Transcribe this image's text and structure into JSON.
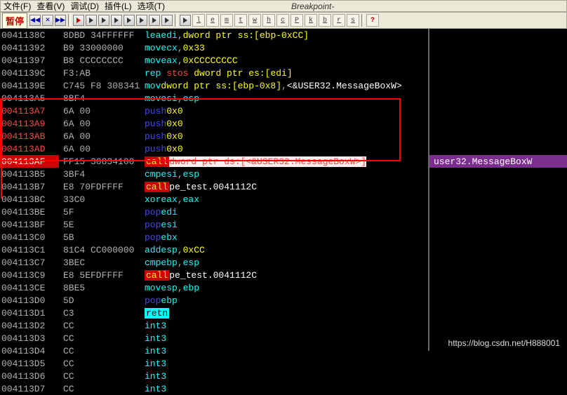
{
  "menu": {
    "file": "文件(F)",
    "view": "查看(V)",
    "debug": "调试(D)",
    "plugins": "插件(L)",
    "options": "选项(T)",
    "bp": "Breakpoint-"
  },
  "status": "暂停",
  "toolbarButtons": [
    "◀◀",
    "✕",
    "▶▶",
    "▶",
    "‖",
    "◀",
    "▶",
    "↓",
    "↓",
    "↔",
    "↔",
    "→",
    "l",
    "e",
    "m",
    "t",
    "w",
    "h",
    "c",
    "P",
    "k",
    "b",
    "r",
    "s"
  ],
  "qmark": "?",
  "rows": [
    {
      "a": "0041138C",
      "b": "8DBD 34FFFFFF",
      "m": "lea",
      "mc": "teal",
      "o": [
        {
          "t": "edi",
          "c": "teal"
        },
        {
          "t": ",",
          "c": "gray"
        },
        {
          "t": "dword ptr ss:[ebp-0xCC]",
          "c": "yel"
        }
      ]
    },
    {
      "a": "00411392",
      "b": "B9 33000000",
      "m": "mov",
      "mc": "teal",
      "o": [
        {
          "t": "ecx",
          "c": "teal"
        },
        {
          "t": ",",
          "c": "gray"
        },
        {
          "t": "0x33",
          "c": "yel"
        }
      ]
    },
    {
      "a": "00411397",
      "b": "B8 CCCCCCCC",
      "m": "mov",
      "mc": "teal",
      "o": [
        {
          "t": "eax",
          "c": "teal"
        },
        {
          "t": ",",
          "c": "gray"
        },
        {
          "t": "0xCCCCCCCC",
          "c": "yel"
        }
      ]
    },
    {
      "a": "0041139C",
      "b": "F3:AB",
      "m": "rep stos",
      "mc": "red-y",
      "o": [
        {
          "t": "dword ptr es:[edi]",
          "c": "yel"
        }
      ]
    },
    {
      "a": "0041139E",
      "b": "C745 F8 308341",
      "m": "mov",
      "mc": "teal",
      "o": [
        {
          "t": "dword ptr ss:[ebp-0x8]",
          "c": "yel"
        },
        {
          "t": ",",
          "c": "gray"
        },
        {
          "t": "<&USER32.MessageBoxW>",
          "c": "white"
        }
      ]
    },
    {
      "a": "004113A5",
      "b": "8BF4",
      "m": "mov",
      "mc": "teal",
      "o": [
        {
          "t": "esi",
          "c": "teal"
        },
        {
          "t": ",",
          "c": "gray"
        },
        {
          "t": "esp",
          "c": "teal"
        }
      ]
    },
    {
      "a": "004113A7",
      "b": "6A 00",
      "m": "push",
      "mc": "blue",
      "o": [
        {
          "t": "0x0",
          "c": "yel"
        }
      ],
      "red": true
    },
    {
      "a": "004113A9",
      "b": "6A 00",
      "m": "push",
      "mc": "blue",
      "o": [
        {
          "t": "0x0",
          "c": "yel"
        }
      ],
      "red": true
    },
    {
      "a": "004113AB",
      "b": "6A 00",
      "m": "push",
      "mc": "blue",
      "o": [
        {
          "t": "0x0",
          "c": "yel"
        }
      ],
      "red": true
    },
    {
      "a": "004113AD",
      "b": "6A 00",
      "m": "push",
      "mc": "blue",
      "o": [
        {
          "t": "0x0",
          "c": "yel"
        }
      ],
      "red": true
    },
    {
      "a": "004113AF",
      "b": "FF15 30834100",
      "m": "call",
      "mc": "redbg",
      "o": [
        {
          "t": "dword ptr ds:[<&USER32.MessageBoxW>]",
          "c": "hl"
        }
      ],
      "sel": true,
      "cmt": "user32.MessageBoxW"
    },
    {
      "a": "004113B5",
      "b": "3BF4",
      "m": "cmp",
      "mc": "teal",
      "o": [
        {
          "t": "esi",
          "c": "teal"
        },
        {
          "t": ",",
          "c": "gray"
        },
        {
          "t": "esp",
          "c": "teal"
        }
      ]
    },
    {
      "a": "004113B7",
      "b": "E8 70FDFFFF",
      "m": "call",
      "mc": "redbg",
      "o": [
        {
          "t": "pe_test.0041112C",
          "c": "white"
        }
      ]
    },
    {
      "a": "004113BC",
      "b": "33C0",
      "m": "xor",
      "mc": "teal",
      "o": [
        {
          "t": "eax",
          "c": "teal"
        },
        {
          "t": ",",
          "c": "gray"
        },
        {
          "t": "eax",
          "c": "teal"
        }
      ]
    },
    {
      "a": "004113BE",
      "b": "5F",
      "m": "pop",
      "mc": "blue",
      "o": [
        {
          "t": "edi",
          "c": "teal"
        }
      ]
    },
    {
      "a": "004113BF",
      "b": "5E",
      "m": "pop",
      "mc": "blue",
      "o": [
        {
          "t": "esi",
          "c": "teal"
        }
      ]
    },
    {
      "a": "004113C0",
      "b": "5B",
      "m": "pop",
      "mc": "blue",
      "o": [
        {
          "t": "ebx",
          "c": "teal"
        }
      ]
    },
    {
      "a": "004113C1",
      "b": "81C4 CC000000",
      "m": "add",
      "mc": "teal",
      "o": [
        {
          "t": "esp",
          "c": "teal"
        },
        {
          "t": ",",
          "c": "gray"
        },
        {
          "t": "0xCC",
          "c": "yel"
        }
      ]
    },
    {
      "a": "004113C7",
      "b": "3BEC",
      "m": "cmp",
      "mc": "teal",
      "o": [
        {
          "t": "ebp",
          "c": "teal"
        },
        {
          "t": ",",
          "c": "gray"
        },
        {
          "t": "esp",
          "c": "teal"
        }
      ]
    },
    {
      "a": "004113C9",
      "b": "E8 5EFDFFFF",
      "m": "call",
      "mc": "redbg",
      "o": [
        {
          "t": "pe_test.0041112C",
          "c": "white"
        }
      ]
    },
    {
      "a": "004113CE",
      "b": "8BE5",
      "m": "mov",
      "mc": "teal",
      "o": [
        {
          "t": "esp",
          "c": "teal"
        },
        {
          "t": ",",
          "c": "gray"
        },
        {
          "t": "ebp",
          "c": "teal"
        }
      ]
    },
    {
      "a": "004113D0",
      "b": "5D",
      "m": "pop",
      "mc": "blue",
      "o": [
        {
          "t": "ebp",
          "c": "teal"
        }
      ]
    },
    {
      "a": "004113D1",
      "b": "C3",
      "m": "retn",
      "mc": "cyanbg",
      "o": []
    },
    {
      "a": "004113D2",
      "b": "CC",
      "m": "int3",
      "mc": "teal",
      "o": []
    },
    {
      "a": "004113D3",
      "b": "CC",
      "m": "int3",
      "mc": "teal",
      "o": []
    },
    {
      "a": "004113D4",
      "b": "CC",
      "m": "int3",
      "mc": "teal",
      "o": []
    },
    {
      "a": "004113D5",
      "b": "CC",
      "m": "int3",
      "mc": "teal",
      "o": []
    },
    {
      "a": "004113D6",
      "b": "CC",
      "m": "int3",
      "mc": "teal",
      "o": []
    },
    {
      "a": "004113D7",
      "b": "CC",
      "m": "int3",
      "mc": "teal",
      "o": []
    }
  ],
  "watermark": "https://blog.csdn.net/H888001"
}
